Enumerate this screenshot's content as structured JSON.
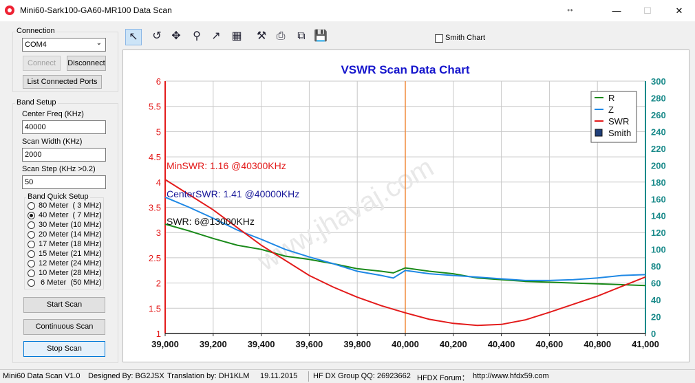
{
  "window": {
    "title": "Mini60-Sark100-GA60-MR100 Data Scan",
    "resize_glyph": "↔",
    "min_glyph": "—",
    "max_glyph": "☐",
    "close_glyph": "✕"
  },
  "connection": {
    "group_label": "Connection",
    "port_value": "COM4",
    "connect_label": "Connect",
    "disconnect_label": "Disconnect",
    "list_ports_label": "List Connected Ports"
  },
  "band_setup": {
    "group_label": "Band Setup",
    "center_freq_label": "Center Freq  (KHz)",
    "center_freq_value": "40000",
    "scan_width_label": "Scan Width   (KHz)",
    "scan_width_value": "2000",
    "scan_step_label": "Scan Step     (KHz >0.2)",
    "scan_step_value": "50",
    "quick_setup_label": "Band Quick Setup",
    "bands": [
      {
        "label": "80 Meter  ( 3 MHz)",
        "checked": false
      },
      {
        "label": "40 Meter  ( 7 MHz)",
        "checked": true
      },
      {
        "label": "30 Meter (10 MHz)",
        "checked": false
      },
      {
        "label": "20 Meter (14 MHz)",
        "checked": false
      },
      {
        "label": "17 Meter (18 MHz)",
        "checked": false
      },
      {
        "label": "15 Meter (21 MHz)",
        "checked": false
      },
      {
        "label": "12 Meter (24 MHz)",
        "checked": false
      },
      {
        "label": "10 Meter (28 MHz)",
        "checked": false
      },
      {
        "label": " 6 Meter  (50 MHz)",
        "checked": false
      }
    ]
  },
  "actions": {
    "start_scan": "Start Scan",
    "continuous_scan": "Continuous Scan",
    "stop_scan": "Stop Scan"
  },
  "toolbar": {
    "tools": [
      "pointer-icon",
      "undo-icon",
      "pan-icon",
      "zoom-icon",
      "export-icon",
      "chart-data-icon",
      "settings-icon",
      "print-icon",
      "copy-icon",
      "save-icon"
    ],
    "smith_chart_label": "Smith Chart",
    "smith_chart_checked": false
  },
  "chart_data": {
    "type": "line",
    "title": "VSWR Scan Data Chart",
    "x_ticks": [
      "39,000",
      "39,200",
      "39,400",
      "39,600",
      "39,800",
      "40,000",
      "40,200",
      "40,400",
      "40,600",
      "40,800",
      "41,000"
    ],
    "xlim": [
      39000,
      41000
    ],
    "y_left_ticks": [
      "1",
      "1.5",
      "2",
      "2.5",
      "3",
      "3.5",
      "4",
      "4.5",
      "5",
      "5.5",
      "6"
    ],
    "y_left_lim": [
      1,
      6
    ],
    "y_right_ticks": [
      "0",
      "20",
      "40",
      "60",
      "80",
      "100",
      "120",
      "140",
      "160",
      "180",
      "200",
      "220",
      "240",
      "260",
      "280",
      "300"
    ],
    "y_right_lim": [
      0,
      300
    ],
    "marker_x": 40000,
    "grid": true,
    "legend_position": "top-right",
    "legend": [
      {
        "name": "R",
        "color": "#1a8a1a",
        "kind": "line"
      },
      {
        "name": "Z",
        "color": "#1e88e5",
        "kind": "line"
      },
      {
        "name": "SWR",
        "color": "#e31b1b",
        "kind": "line"
      },
      {
        "name": "Smith",
        "color": "#1f3f7a",
        "kind": "box"
      }
    ],
    "annotations": [
      {
        "text": "MinSWR: 1.16 @40300KHz",
        "color": "#e31b1b"
      },
      {
        "text": "CenterSWR: 1.41 @40000KHz",
        "color": "#1a1a9a"
      },
      {
        "text": "SWR: 6@13000KHz",
        "color": "#111111"
      }
    ],
    "series": [
      {
        "name": "R",
        "axis": "right",
        "color": "#1a8a1a",
        "x": [
          39000,
          39100,
          39200,
          39300,
          39400,
          39500,
          39600,
          39700,
          39800,
          39900,
          39950,
          40000,
          40100,
          40200,
          40300,
          40400,
          40500,
          40600,
          40700,
          40800,
          40900,
          41000
        ],
        "y": [
          130,
          122,
          113,
          105,
          100,
          92,
          88,
          83,
          77,
          74,
          72,
          78,
          74,
          71,
          66,
          64,
          62,
          61,
          60,
          59,
          58,
          57
        ]
      },
      {
        "name": "Z",
        "axis": "right",
        "color": "#1e88e5",
        "x": [
          39000,
          39100,
          39200,
          39300,
          39400,
          39500,
          39600,
          39700,
          39800,
          39900,
          39950,
          40000,
          40100,
          40200,
          40300,
          40400,
          40500,
          40600,
          40700,
          40800,
          40900,
          41000
        ],
        "y": [
          162,
          150,
          137,
          123,
          112,
          100,
          91,
          83,
          74,
          69,
          66,
          75,
          71,
          69,
          67,
          65,
          63,
          63,
          64,
          66,
          69,
          70
        ]
      },
      {
        "name": "SWR",
        "axis": "left",
        "color": "#e31b1b",
        "x": [
          39000,
          39100,
          39200,
          39300,
          39400,
          39500,
          39600,
          39700,
          39800,
          39900,
          40000,
          40100,
          40200,
          40300,
          40400,
          40500,
          40600,
          40700,
          40800,
          40900,
          41000
        ],
        "y": [
          4.05,
          3.75,
          3.45,
          3.1,
          2.75,
          2.45,
          2.15,
          1.92,
          1.72,
          1.55,
          1.41,
          1.28,
          1.2,
          1.16,
          1.18,
          1.27,
          1.42,
          1.58,
          1.74,
          1.93,
          2.12
        ]
      }
    ]
  },
  "watermark": "www.jhavaj.com",
  "status": {
    "version": "Mini60 Data Scan V1.0",
    "designed_by": "Designed By: BG2JSX",
    "translation": "Translation by: DH1KLM",
    "date": "19.11.2015",
    "group_qq": "HF DX Group QQ: 26923662",
    "forum": "HFDX Forum：",
    "url": "http://www.hfdx59.com"
  }
}
